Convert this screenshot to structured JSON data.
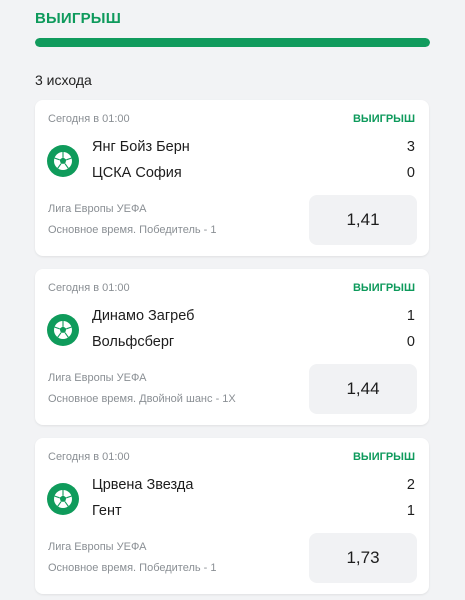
{
  "header": {
    "title": "ВЫИГРЫШ",
    "progress": 1.0,
    "accent_color": "#0e9a5c"
  },
  "summary": {
    "outcome_count": "3 исхода"
  },
  "bets": [
    {
      "date": "Сегодня в 01:00",
      "status": "ВЫИГРЫШ",
      "sport_icon": "soccer-ball-icon",
      "team1": "Янг Бойз Берн",
      "score1": "3",
      "team2": "ЦСКА София",
      "score2": "0",
      "league": "Лига Европы УЕФА",
      "market": "Основное время. Победитель - 1",
      "odds": "1,41"
    },
    {
      "date": "Сегодня в 01:00",
      "status": "ВЫИГРЫШ",
      "sport_icon": "soccer-ball-icon",
      "team1": "Динамо Загреб",
      "score1": "1",
      "team2": "Вольфсберг",
      "score2": "0",
      "league": "Лига Европы УЕФА",
      "market": "Основное время. Двойной шанс - 1Х",
      "odds": "1,44"
    },
    {
      "date": "Сегодня в 01:00",
      "status": "ВЫИГРЫШ",
      "sport_icon": "soccer-ball-icon",
      "team1": "Црвена Звезда",
      "score1": "2",
      "team2": "Гент",
      "score2": "1",
      "league": "Лига Европы УЕФА",
      "market": "Основное время. Победитель - 1",
      "odds": "1,73"
    }
  ]
}
